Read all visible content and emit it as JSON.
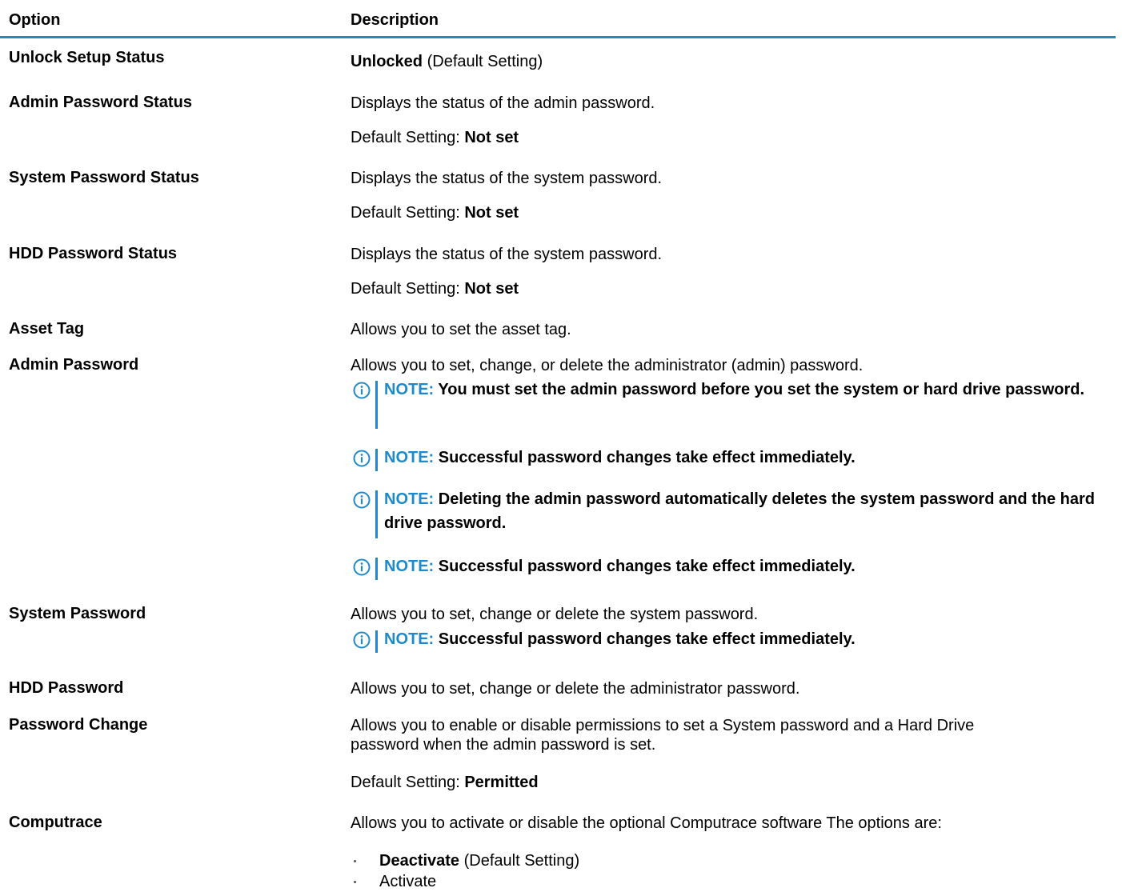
{
  "table": {
    "headers": {
      "option": "Option",
      "description": "Description"
    },
    "rows": [
      {
        "option": "Unlock Setup Status",
        "value_bold": "Unlocked",
        "value_rest": " (Default Setting)"
      },
      {
        "option": "Admin Password Status",
        "desc": "Displays the status of the admin password.",
        "default_label": "Default Setting: ",
        "default_value": "Not set"
      },
      {
        "option": "System Password Status",
        "desc": "Displays the status of the system password.",
        "default_label": "Default Setting: ",
        "default_value": "Not set"
      },
      {
        "option": "HDD Password Status",
        "desc": "Displays the status of the system password.",
        "default_label": "Default Setting: ",
        "default_value": "Not set"
      },
      {
        "option": "Asset Tag",
        "desc": "Allows you to set the asset tag."
      },
      {
        "option": "Admin Password",
        "desc": "Allows you to set, change, or delete the administrator (admin) password.",
        "notes": [
          {
            "label": "NOTE: ",
            "text": "You must set the admin password before you set the system or hard drive password."
          },
          {
            "label": "NOTE: ",
            "text": "Successful password changes take effect immediately."
          },
          {
            "label": "NOTE: ",
            "text": "Deleting the admin password automatically deletes the system password and the hard drive password."
          },
          {
            "label": "NOTE: ",
            "text": "Successful password changes take effect immediately."
          }
        ]
      },
      {
        "option": "System Password",
        "desc": "Allows you to set, change or delete the system password.",
        "notes": [
          {
            "label": "NOTE: ",
            "text": "Successful password changes take effect immediately."
          }
        ]
      },
      {
        "option": "HDD Password",
        "desc": "Allows you to set, change or delete the administrator password."
      },
      {
        "option": "Password Change",
        "desc_line1": "Allows you to enable or disable permissions to set a System password and a Hard Drive",
        "desc_line2": "password when the admin password is set.",
        "default_label": "Default Setting: ",
        "default_value": "Permitted"
      },
      {
        "option": "Computrace",
        "desc": "Allows you to activate or disable the optional Computrace software The options are:",
        "bullets": [
          {
            "bold": "Deactivate",
            "rest": " (Default Setting)"
          },
          {
            "bold": "",
            "rest": "Activate"
          }
        ]
      }
    ]
  },
  "colors": {
    "accent": "#1f8ac9",
    "text": "#000000"
  },
  "icons": {
    "note": "info-circle-icon"
  }
}
